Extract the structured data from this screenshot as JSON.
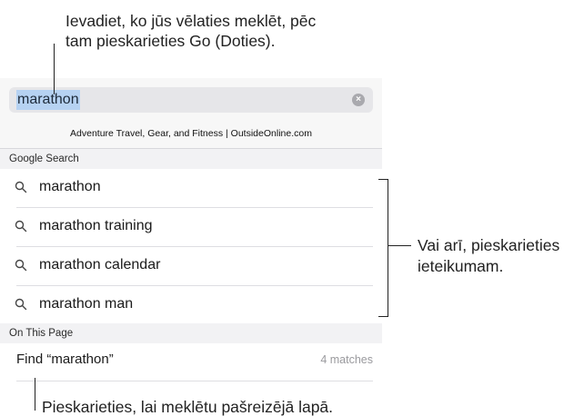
{
  "callouts": {
    "top_line1": "Ievadiet, ko jūs vēlaties meklēt, pēc",
    "top_line2": "tam pieskarieties Go (Doties).",
    "right_line1": "Vai arī, pieskarieties",
    "right_line2": "ieteikumam.",
    "bottom": "Pieskarieties, lai meklētu pašreizējā lapā."
  },
  "search": {
    "value": "marathon",
    "clear_icon": "clear-icon"
  },
  "top_hit": "Adventure Travel, Gear, and Fitness | OutsideOnline.com",
  "google_section": {
    "header": "Google Search",
    "suggestions": [
      {
        "label": "marathon"
      },
      {
        "label": "marathon training"
      },
      {
        "label": "marathon calendar"
      },
      {
        "label": "marathon man"
      }
    ]
  },
  "page_section": {
    "header": "On This Page",
    "find_label": "Find “marathon”",
    "match_count": "4 matches"
  }
}
